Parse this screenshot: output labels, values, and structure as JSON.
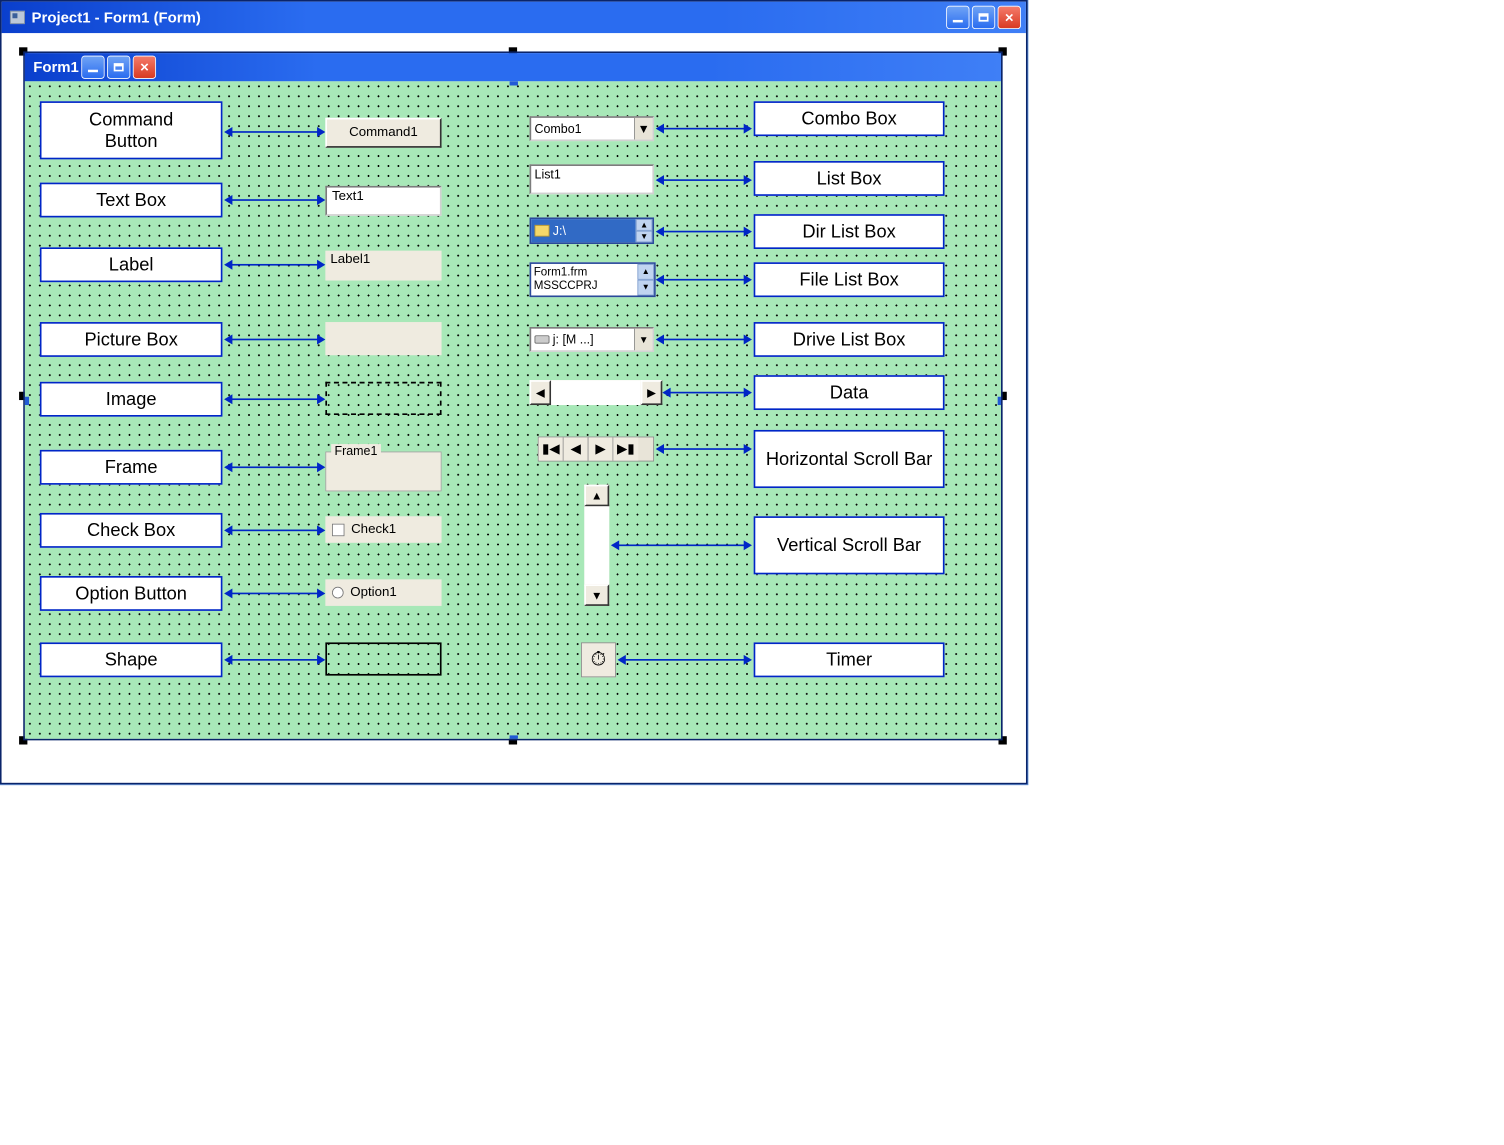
{
  "outer_window": {
    "title": "Project1 - Form1 (Form)"
  },
  "inner_window": {
    "title": "Form1"
  },
  "left_labels": {
    "command_button": "Command\nButton",
    "text_box": "Text Box",
    "label": "Label",
    "picture_box": "Picture Box",
    "image": "Image",
    "frame": "Frame",
    "check_box": "Check Box",
    "option_button": "Option Button",
    "shape": "Shape"
  },
  "right_labels": {
    "combo_box": "Combo Box",
    "list_box": "List Box",
    "dir_list": "Dir List Box",
    "file_list": "File List Box",
    "drive_list": "Drive List Box",
    "data": "Data",
    "hscroll": "Horizontal Scroll Bar",
    "vscroll": "Vertical Scroll Bar",
    "timer": "Timer"
  },
  "controls": {
    "button_caption": "Command1",
    "textbox_value": "Text1",
    "label_caption": "Label1",
    "frame_caption": "Frame1",
    "check_caption": "Check1",
    "option_caption": "Option1",
    "combo_value": "Combo1",
    "list_value": "List1",
    "dir_value": "J:\\",
    "file_row1": "Form1.frm",
    "file_row2": "MSSCCPRJ",
    "drive_value": "j: [M ...]"
  }
}
